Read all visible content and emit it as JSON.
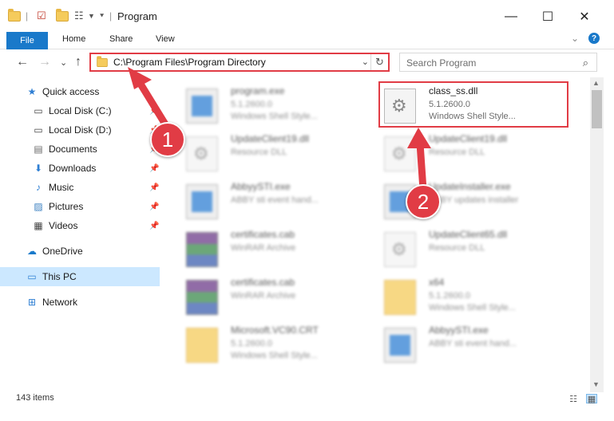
{
  "window": {
    "title": "Program",
    "minimize_glyph": "—",
    "maximize_glyph": "☐",
    "close_glyph": "✕"
  },
  "ribbon": {
    "file_tab": "File",
    "tabs": [
      "Home",
      "Share",
      "View"
    ],
    "help_glyph": "?",
    "expand_glyph": "⌄"
  },
  "address_bar": {
    "path": "C:\\Program Files\\Program Directory",
    "chevron_glyph": "⌄",
    "refresh_glyph": "↻"
  },
  "search": {
    "placeholder": "Search Program",
    "icon_glyph": "⌕"
  },
  "nav_glyphs": {
    "back": "←",
    "forward": "→",
    "recent": "⌄",
    "up": "↑"
  },
  "nav_pane": {
    "items": [
      {
        "label": "Quick access",
        "icon": "star-icon",
        "glyph": "★",
        "color": "#2f7fd3"
      },
      {
        "label": "Local Disk (C:)",
        "icon": "drive-icon",
        "glyph": "▭",
        "color": "#444444"
      },
      {
        "label": "Local Disk (D:)",
        "icon": "drive-icon",
        "glyph": "▭",
        "color": "#444444"
      },
      {
        "label": "Documents",
        "icon": "documents-icon",
        "glyph": "▤",
        "color": "#6a6a6a"
      },
      {
        "label": "Downloads",
        "icon": "download-icon",
        "glyph": "⬇",
        "color": "#2f7fd3"
      },
      {
        "label": "Music",
        "icon": "music-icon",
        "glyph": "♪",
        "color": "#2f7fd3"
      },
      {
        "label": "Pictures",
        "icon": "pictures-icon",
        "glyph": "▨",
        "color": "#3a7fc0"
      },
      {
        "label": "Videos",
        "icon": "videos-icon",
        "glyph": "▦",
        "color": "#444444"
      },
      {
        "label": "OneDrive",
        "icon": "cloud-icon",
        "glyph": "☁",
        "color": "#1979ca"
      },
      {
        "label": "This PC",
        "icon": "computer-icon",
        "glyph": "▭",
        "color": "#2f7fd3"
      },
      {
        "label": "Network",
        "icon": "network-icon",
        "glyph": "⊞",
        "color": "#2f7fd3"
      }
    ],
    "pin_glyph": "📌"
  },
  "files": [
    {
      "name": "program.exe",
      "line2": "5.1.2600.0",
      "line3": "Windows Shell Style...",
      "type": "exe",
      "blurred": true
    },
    {
      "name": "class_ss.dll",
      "line2": "5.1.2600.0",
      "line3": "Windows Shell Style...",
      "type": "dll",
      "blurred": false
    },
    {
      "name": "UpdateClient19.dll",
      "line2": "Resource DLL",
      "line3": "",
      "type": "dll",
      "blurred": true
    },
    {
      "name": "UpdateClient19.dll",
      "line2": "Resource DLL",
      "line3": "",
      "type": "dll",
      "blurred": true
    },
    {
      "name": "AbbyySTI.exe",
      "line2": "ABBY sti event hand...",
      "line3": "",
      "type": "exe",
      "blurred": true
    },
    {
      "name": "UpdateInstaller.exe",
      "line2": "ABBY updates installer",
      "line3": "",
      "type": "exe",
      "blurred": true
    },
    {
      "name": "certificates.cab",
      "line2": "WinRAR Archive",
      "line3": "",
      "type": "cab",
      "blurred": true
    },
    {
      "name": "UpdateClient65.dll",
      "line2": "Resource DLL",
      "line3": "",
      "type": "dll",
      "blurred": true
    },
    {
      "name": "certificates.cab",
      "line2": "WinRAR Archive",
      "line3": "",
      "type": "cab",
      "blurred": true
    },
    {
      "name": "x64",
      "line2": "5.1.2600.0",
      "line3": "Windows Shell Style...",
      "type": "folder",
      "blurred": true
    },
    {
      "name": "Microsoft.VC90.CRT",
      "line2": "5.1.2600.0",
      "line3": "Windows Shell Style...",
      "type": "folder",
      "blurred": true
    },
    {
      "name": "AbbyySTI.exe",
      "line2": "ABBY sti event hand...",
      "line3": "",
      "type": "exe",
      "blurred": true
    }
  ],
  "status_bar": {
    "item_count": "143 items",
    "details_view_glyph": "☷",
    "tiles_view_glyph": "▦"
  },
  "annotations": {
    "step1": "1",
    "step2": "2",
    "accent_color": "#e13c45"
  },
  "scrollbar": {
    "up_glyph": "▲",
    "down_glyph": "▼"
  }
}
